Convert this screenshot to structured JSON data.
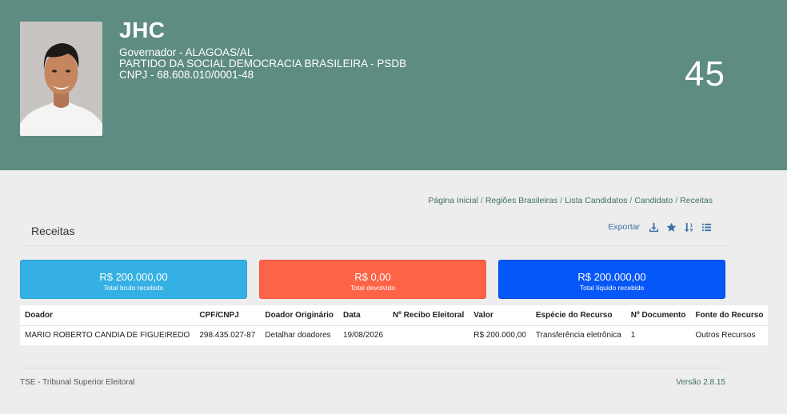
{
  "candidate": {
    "name": "JHC",
    "office_line": "Governador - ALAGOAS/AL",
    "party_line": "PARTIDO DA SOCIAL DEMOCRACIA BRASILEIRA - PSDB",
    "cnpj_line": "CNPJ - 68.608.010/0001-48",
    "number": "45"
  },
  "breadcrumb": {
    "items": [
      "Página Inicial",
      "Regiões Brasileiras",
      "Lista Candidatos",
      "Candidato",
      "Receitas"
    ],
    "separator": "/"
  },
  "section": {
    "title": "Receitas",
    "export_label": "Exportar",
    "icons": [
      "download-icon",
      "star-icon",
      "sort-icon",
      "list-icon"
    ],
    "icon_color": "#3a6fa5"
  },
  "cards": {
    "bruto": {
      "amount": "R$ 200.000,00",
      "caption": "Total bruto recebido",
      "color": "#35b0e4"
    },
    "devolvido": {
      "amount": "R$ 0,00",
      "caption": "Total devolvido",
      "color": "#fc6347"
    },
    "liquido": {
      "amount": "R$ 200.000,00",
      "caption": "Total líquido recebido",
      "color": "#0657f7"
    }
  },
  "table": {
    "headers": [
      "Doador",
      "CPF/CNPJ",
      "Doador Originário",
      "Data",
      "Nº Recibo Eleitoral",
      "Valor",
      "Espécie do Recurso",
      "Nº Documento",
      "Fonte do Recurso"
    ],
    "rows": [
      [
        "MARIO ROBERTO CANDIA DE FIGUEIREDO",
        "298.435.027-87",
        "Detalhar doadores",
        "19/08/2026",
        "",
        "R$ 200.000,00",
        "Transferência eletrônica",
        "1",
        "Outros Recursos"
      ]
    ]
  },
  "footer": {
    "left": "TSE - Tribunal Superior Eleitoral",
    "version": "Versão 2.8.15"
  },
  "colors": {
    "header_bg": "#5e8c82",
    "page_bg": "#ededed",
    "link_green": "#3f6f64"
  }
}
